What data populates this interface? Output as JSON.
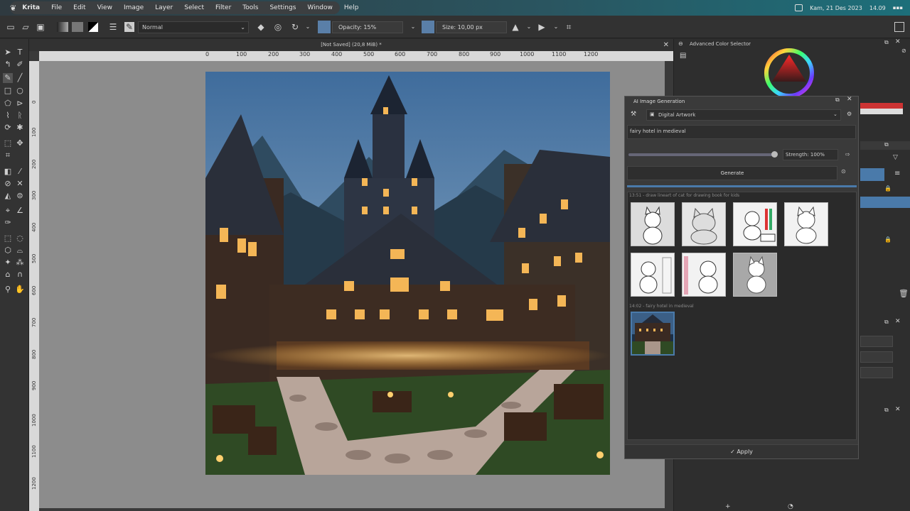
{
  "menubar": {
    "app": "Krita",
    "menus": [
      "File",
      "Edit",
      "View",
      "Image",
      "Layer",
      "Select",
      "Filter",
      "Tools",
      "Settings",
      "Window",
      "Help"
    ],
    "date": "Kam, 21 Des 2023",
    "time": "14.09"
  },
  "toolbar": {
    "blend_mode": "Normal",
    "opacity": "Opacity: 15%",
    "size": "Size: 10,00 px"
  },
  "document": {
    "tab_title": "[Not Saved] (20,8 MiB) *",
    "ruler_marks": [
      "0",
      "100",
      "200",
      "300",
      "400",
      "500",
      "600",
      "700",
      "800",
      "900",
      "1000",
      "1100",
      "1200"
    ],
    "vruler_marks": [
      "0",
      "100",
      "200",
      "300",
      "400",
      "500",
      "600",
      "700",
      "800",
      "900",
      "1000",
      "1100",
      "1200"
    ]
  },
  "right_dock": {
    "color_selector_title": "Advanced Color Selector",
    "accent": "#4a7aaa"
  },
  "ai_panel": {
    "title": "AI Image Generation",
    "style": "Digital Artwork",
    "prompt": "fairy hotel in medieval",
    "strength": "Strength: 100%",
    "generate_label": "Generate",
    "group1": "13:51 - draw lineart of cat for drawing book for kids",
    "group2": "14:02 - fairy hotel in medieval",
    "apply_label": "Apply"
  }
}
